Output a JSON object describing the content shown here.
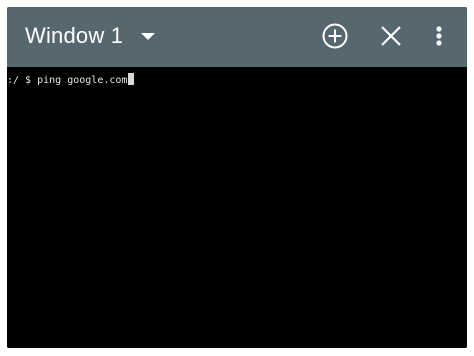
{
  "app_bar": {
    "window_title": "Window 1",
    "background": "#56676f",
    "dropdown_icon": "arrow-drop-down-icon",
    "actions": [
      {
        "name": "new-window",
        "icon": "add-circle-outline-icon"
      },
      {
        "name": "close-window",
        "icon": "close-icon"
      },
      {
        "name": "overflow-menu",
        "icon": "more-vert-icon"
      }
    ]
  },
  "terminal": {
    "background": "#000000",
    "prompt": ":/ $ ",
    "command": "ping google.com",
    "text_color": "#e6e6e6"
  }
}
